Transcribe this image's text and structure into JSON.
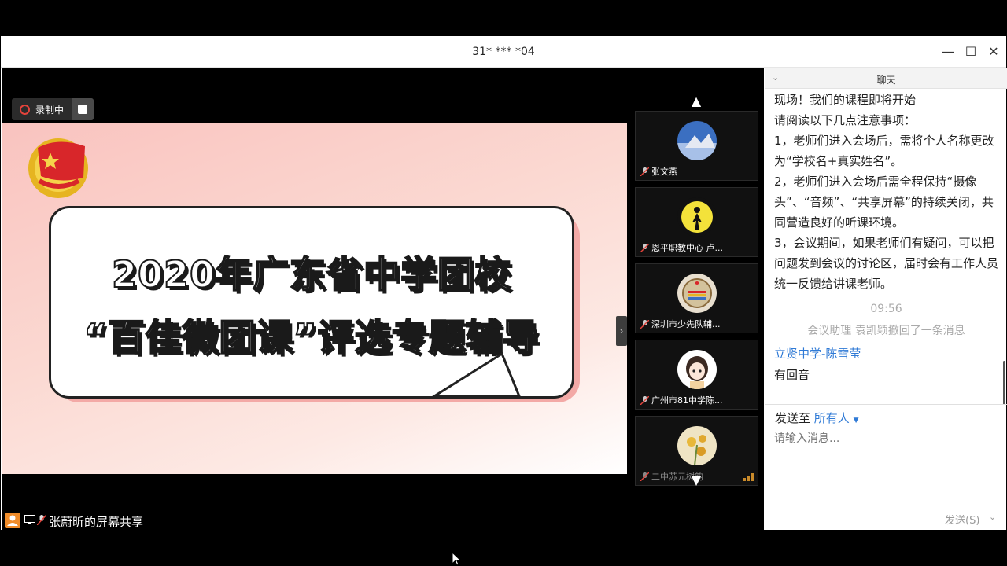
{
  "window": {
    "title": "31* *** *04",
    "minimize": "—",
    "maximize": "☐",
    "close": "✕"
  },
  "recording": {
    "label": "录制中"
  },
  "slide": {
    "line1": "2020年广东省中学团校",
    "line2": "“百佳微团课”评选专题辅导"
  },
  "participants": [
    {
      "name": "张文燕"
    },
    {
      "name": "恩平职教中心 卢..."
    },
    {
      "name": "深圳市少先队辅..."
    },
    {
      "name": "广州市81中学陈..."
    },
    {
      "name": "二中苏元树韵"
    }
  ],
  "share": {
    "label": "张蔚昕的屏幕共享"
  },
  "chat": {
    "header": "聊天",
    "messages": [
      "现场！我们的课程即将开始",
      "请阅读以下几点注意事项：",
      "1，老师们进入会场后，需将个人名称更改为“学校名+真实姓名”。",
      "2，老师们进入会场后需全程保持“摄像头”、“音频”、“共享屏幕”的持续关闭，共同营造良好的听课环境。",
      "3，会议期间，如果老师们有疑问，可以把问题发到会议的讨论区，届时会有工作人员统一反馈给讲课老师。"
    ],
    "time": "09:56",
    "system": "会议助理 袁凯颖撤回了一条消息",
    "sender": "立贤中学-陈雪莹",
    "reply": "有回音",
    "send_to_label": "发送至",
    "send_to_target": "所有人",
    "input_placeholder": "请输入消息...",
    "send_button": "发送(S)"
  },
  "colors": {
    "accent": "#2f7ad6",
    "record": "#e5433b",
    "share": "#f08c2a"
  }
}
